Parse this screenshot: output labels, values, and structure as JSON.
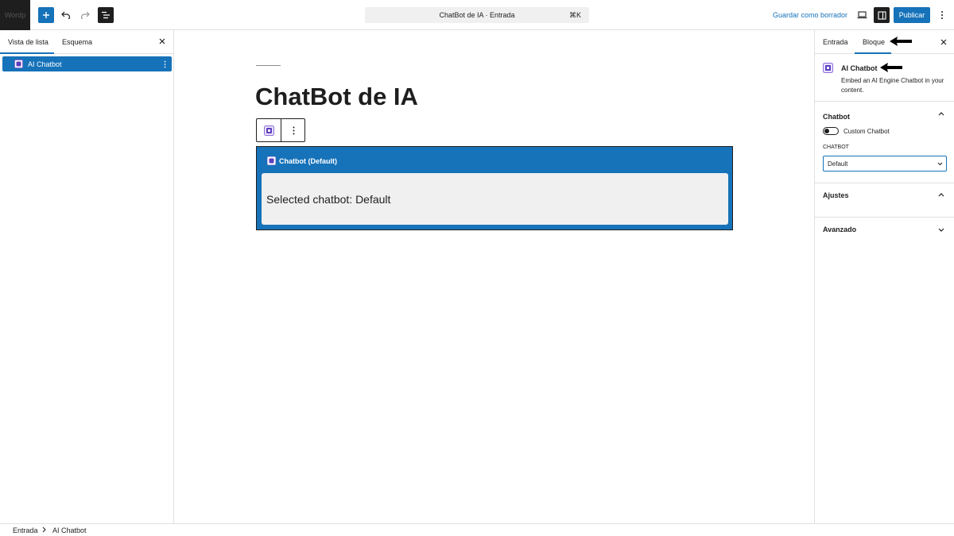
{
  "toolbar": {
    "site_logo_text": "Wordp",
    "command_bar_title": "ChatBot de IA · Entrada",
    "command_bar_shortcut": "⌘K",
    "save_draft_label": "Guardar como borrador",
    "publish_label": "Publicar"
  },
  "left_panel": {
    "tabs": [
      {
        "label": "Vista de lista"
      },
      {
        "label": "Esquema"
      }
    ],
    "items": [
      {
        "label": "AI Chatbot"
      }
    ]
  },
  "canvas": {
    "post_title": "ChatBot de IA",
    "block": {
      "header": "Chatbot (Default)",
      "body_text": "Selected chatbot: Default"
    }
  },
  "right_panel": {
    "tabs": [
      {
        "label": "Entrada"
      },
      {
        "label": "Bloque"
      }
    ],
    "block_card": {
      "title": "AI Chatbot",
      "description": "Embed an AI Engine Chatbot in your content."
    },
    "chatbot_section": {
      "title": "Chatbot",
      "toggle_label": "Custom Chatbot",
      "field_label": "CHATBOT",
      "select_value": "Default"
    },
    "ajustes_section": {
      "title": "Ajustes"
    },
    "avanzado_section": {
      "title": "Avanzado"
    }
  },
  "footer": {
    "breadcrumbs": [
      "Entrada",
      "AI Chatbot"
    ]
  },
  "colors": {
    "accent": "#1672b9",
    "dark": "#1e1e1e",
    "border": "#e0e0e0",
    "block_inner": "#f0f0f0"
  }
}
